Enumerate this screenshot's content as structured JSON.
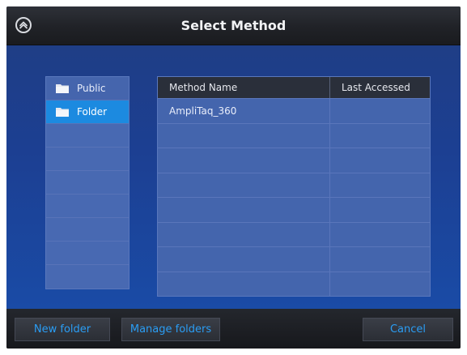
{
  "header": {
    "title": "Select Method",
    "home_icon": "home-icon"
  },
  "folders": [
    {
      "label": "Public",
      "selected": false,
      "icon": "folder-icon"
    },
    {
      "label": "Folder",
      "selected": true,
      "icon": "folder-icon"
    }
  ],
  "table": {
    "columns": [
      "Method Name",
      "Last Accessed"
    ],
    "rows": [
      [
        "AmpliTaq_360",
        ""
      ]
    ]
  },
  "footer": {
    "new_folder_label": "New folder",
    "manage_folders_label": "Manage folders",
    "cancel_label": "Cancel"
  },
  "colors": {
    "accent": "#2a9df4",
    "selected": "#1c8ae0",
    "background": "#1c3f92"
  }
}
